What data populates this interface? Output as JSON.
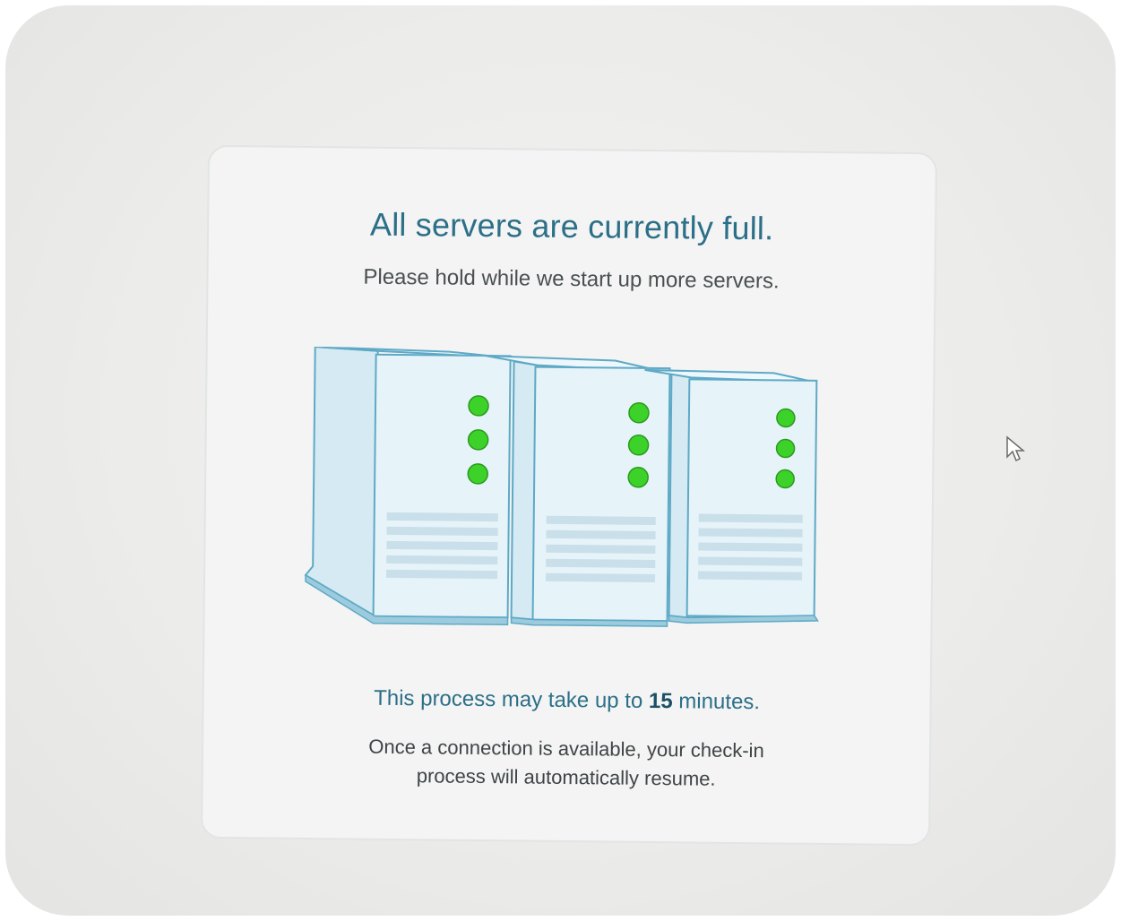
{
  "dialog": {
    "title": "All servers are currently full.",
    "subtitle": "Please hold while we start up more servers.",
    "duration_prefix": "This process may take up to",
    "duration_value": "15",
    "duration_suffix": "minutes.",
    "resume_message": "Once a connection is available, your check-in process will automatically resume."
  },
  "illustration": {
    "icon": "server-towers-icon",
    "server_count": 3,
    "status_lights_per_server": 3,
    "status_light_color": "#3cd22a",
    "tower_color": "#e4f1f7",
    "tower_outline_color": "#5ea9c6"
  },
  "colors": {
    "title": "#2c6f88",
    "body_text": "#3f4447",
    "card_background": "#f3f4f3"
  }
}
